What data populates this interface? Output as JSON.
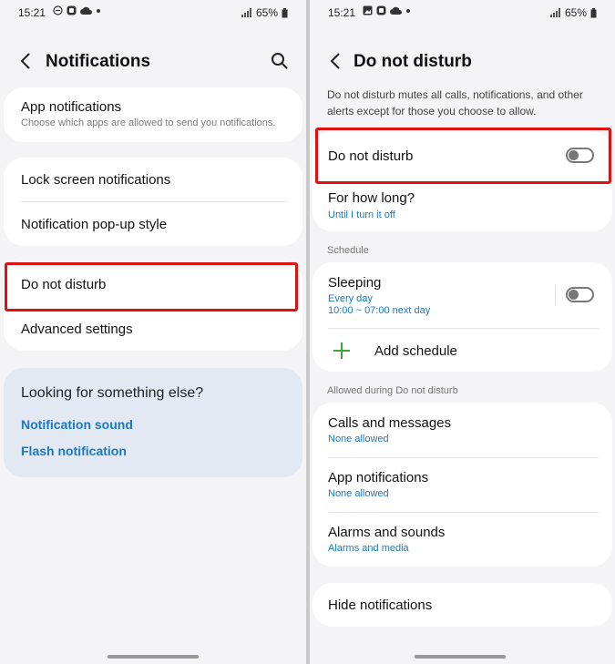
{
  "left": {
    "status": {
      "time": "15:21",
      "battery": "65%"
    },
    "title": "Notifications",
    "app_notifications": {
      "title": "App notifications",
      "subtitle": "Choose which apps are allowed to send you notifications."
    },
    "lock_screen": "Lock screen notifications",
    "popup_style": "Notification pop-up style",
    "do_not_disturb": "Do not disturb",
    "advanced": "Advanced settings",
    "looking": {
      "question": "Looking for something else?",
      "links": [
        "Notification sound",
        "Flash notification"
      ]
    }
  },
  "right": {
    "status": {
      "time": "15:21",
      "battery": "65%"
    },
    "title": "Do not disturb",
    "description": "Do not disturb mutes all calls, notifications, and other alerts except for those you choose to allow.",
    "dnd_toggle": {
      "label": "Do not disturb",
      "on": false
    },
    "for_how_long": {
      "title": "For how long?",
      "value": "Until I turn it off"
    },
    "schedule_header": "Schedule",
    "sleeping": {
      "title": "Sleeping",
      "days": "Every day",
      "time": "10:00 ~ 07:00 next day",
      "on": false
    },
    "add_schedule": "Add schedule",
    "allowed_header": "Allowed during Do not disturb",
    "calls": {
      "title": "Calls and messages",
      "value": "None allowed"
    },
    "apps": {
      "title": "App notifications",
      "value": "None allowed"
    },
    "alarms": {
      "title": "Alarms and sounds",
      "value": "Alarms and media"
    },
    "hide": "Hide notifications"
  },
  "colors": {
    "accent": "#1a79c2",
    "highlight": "#dd1111",
    "toggle_off": "#777777",
    "add_green": "#3aa53a"
  }
}
